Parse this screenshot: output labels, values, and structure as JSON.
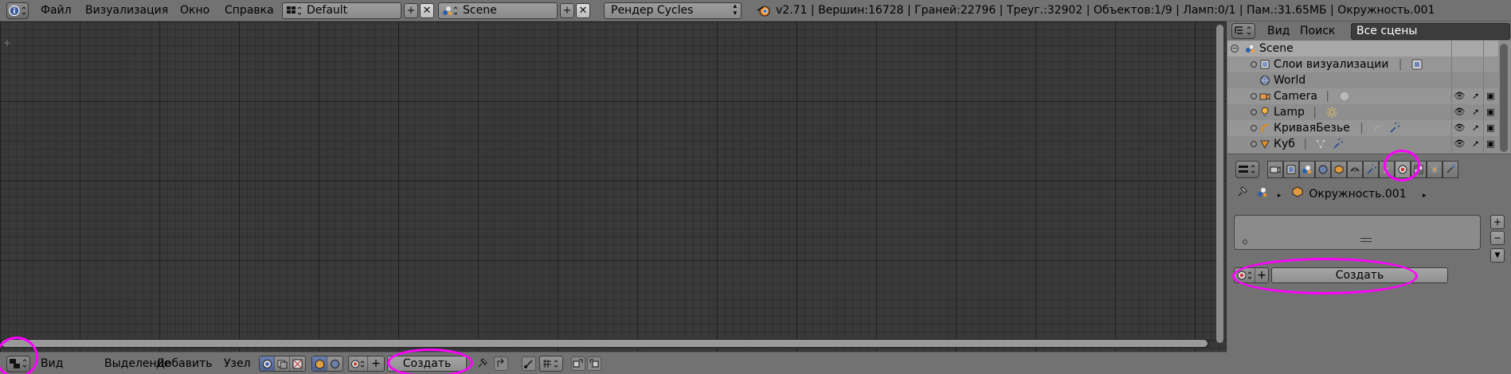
{
  "info_header": {
    "menus": [
      "Файл",
      "Визуализация",
      "Окно",
      "Справка"
    ],
    "layout_name": "Default",
    "scene_name": "Scene",
    "render_engine": "Рендер Cycles",
    "stats": "v2.71 | Вершин:16728 | Граней:22796 | Треуг.:32902 | Объектов:1/9 | Ламп:0/1 | Пам.:31.65МБ | Окружность.001"
  },
  "node_header": {
    "menus": [
      "Вид",
      "Выделение",
      "Добавить",
      "Узел"
    ],
    "create_label": "Создать"
  },
  "outliner": {
    "menus": [
      "Вид",
      "Поиск"
    ],
    "display_mode": "Все сцены",
    "rows": [
      {
        "label": "Scene",
        "icon": "scene-icon"
      },
      {
        "label": "Слои визуализации",
        "icon": "render-layers-icon"
      },
      {
        "label": "World",
        "icon": "world-icon"
      },
      {
        "label": "Camera",
        "icon": "camera-icon"
      },
      {
        "label": "Lamp",
        "icon": "lamp-icon"
      },
      {
        "label": "КриваяБезье",
        "icon": "curve-icon"
      },
      {
        "label": "Куб",
        "icon": "mesh-icon"
      }
    ]
  },
  "properties": {
    "object_name": "Окружность.001",
    "create_label": "Создать"
  },
  "colors": {
    "annotation": "#ff00ff",
    "panel": "#727272",
    "editor_bg": "#393939"
  }
}
